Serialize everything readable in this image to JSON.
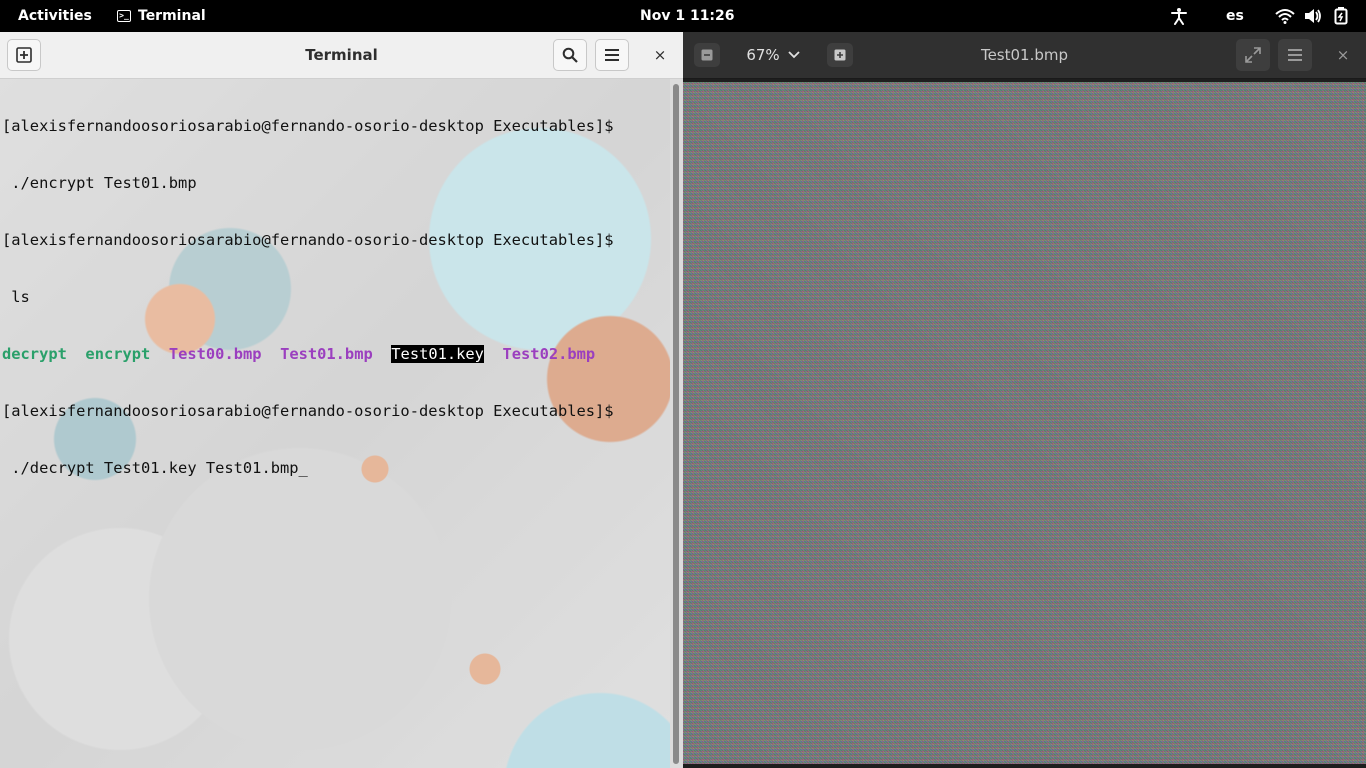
{
  "topbar": {
    "activities": "Activities",
    "app_name": "Terminal",
    "app_icon_glyph": ">_",
    "clock": "Nov 1  11:26",
    "language": "es",
    "tray_icons": [
      "accessibility-icon",
      "wifi-icon",
      "volume-icon",
      "battery-icon"
    ]
  },
  "terminal": {
    "title": "Terminal",
    "close": "×",
    "lines": {
      "l1": "[alexisfernandoosoriosarabio@fernando-osorio-desktop Executables]$",
      "l2": " ./encrypt Test01.bmp",
      "l3": "[alexisfernandoosoriosarabio@fernando-osorio-desktop Executables]$",
      "l4": " ls",
      "l6": "[alexisfernandoosoriosarabio@fernando-osorio-desktop Executables]$",
      "l7": " ./decrypt Test01.key Test01.bmp_"
    },
    "ls_output": {
      "decrypt": "decrypt",
      "encrypt": "encrypt",
      "test00": "Test00.bmp",
      "test01": "Test01.bmp",
      "test01key": "Test01.key",
      "test02": "Test02.bmp"
    },
    "colors": {
      "executable": "#2aa06a",
      "image": "#9b3fbf"
    }
  },
  "viewer": {
    "zoom": "67%",
    "title": "Test01.bmp",
    "close": "×"
  }
}
